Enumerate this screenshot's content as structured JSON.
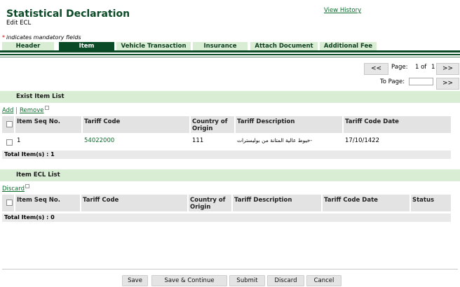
{
  "page": {
    "title": "Statistical Declaration",
    "subtitle": "Edit ECL",
    "history_link": "View History",
    "mandatory_note": "indicates mandatory fields"
  },
  "tabs": [
    {
      "label": "Header",
      "active": false
    },
    {
      "label": "Item",
      "active": true
    },
    {
      "label": "Vehicle Transaction",
      "active": false
    },
    {
      "label": "Insurance",
      "active": false
    },
    {
      "label": "Attach Document",
      "active": false
    },
    {
      "label": "Additional Fee",
      "active": false
    }
  ],
  "pagination": {
    "prev_label": "<<",
    "next_label": ">>",
    "page_label": "Page:",
    "page_of": "1 of",
    "total_pages": "1",
    "to_page_label": "To Page:",
    "to_page_value": "",
    "go_label": ">>"
  },
  "exist_items": {
    "title": "Exist Item List",
    "add_label": "Add",
    "remove_label": "Remove",
    "headers": {
      "seq": "Item Seq No.",
      "tariff": "Tariff Code",
      "country_1": "Country of",
      "country_2": "Origin",
      "desc": "Tariff Description",
      "date": "Tariff Code Date"
    },
    "rows": [
      {
        "seq": "1",
        "tariff": "54022000",
        "country": "111",
        "desc": "خيوط عالية المتانة من بوليسترات-",
        "date": "17/10/1422"
      }
    ],
    "total_label": "Total Item(s) :",
    "total_value": "1"
  },
  "ecl_items": {
    "title": "Item ECL List",
    "discard_label": "Discard",
    "headers": {
      "seq": "Item Seq No.",
      "tariff": "Tariff Code",
      "country_1": "Country of",
      "country_2": "Origin",
      "desc": "Tariff Description",
      "date": "Tariff Code Date",
      "status": "Status"
    },
    "total_label": "Total Item(s) :",
    "total_value": "0"
  },
  "footer": {
    "save": "Save",
    "save_continue": "Save & Continue",
    "submit": "Submit",
    "discard": "Discard",
    "cancel": "Cancel"
  },
  "colors": {
    "brand_dark_green": "#0b4a26",
    "tab_light_green": "#d9ecd4",
    "link_green": "#0b6b2c",
    "mandatory_red": "#cc0000",
    "table_header_gray": "#e3e3e3"
  }
}
